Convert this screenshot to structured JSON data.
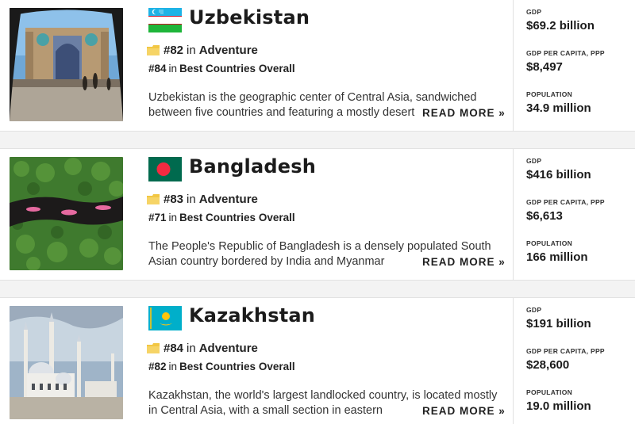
{
  "countries": [
    {
      "name": "Uzbekistan",
      "flag": "uzbekistan-flag",
      "rank_primary": {
        "number": "#82",
        "in": "in",
        "category": "Adventure"
      },
      "rank_secondary": {
        "number": "#84",
        "in": "in",
        "category": "Best Countries Overall"
      },
      "description": "Uzbekistan is the geographic center of Central Asia, sandwiched between five countries and featuring a mostly desert",
      "read_more": "READ MORE »",
      "stats": [
        {
          "label": "GDP",
          "value": "$69.2 billion"
        },
        {
          "label": "GDP PER CAPITA, PPP",
          "value": "$8,497"
        },
        {
          "label": "POPULATION",
          "value": "34.9 million"
        }
      ]
    },
    {
      "name": "Bangladesh",
      "flag": "bangladesh-flag",
      "rank_primary": {
        "number": "#83",
        "in": "in",
        "category": "Adventure"
      },
      "rank_secondary": {
        "number": "#71",
        "in": "in",
        "category": "Best Countries Overall"
      },
      "description": "The People's Republic of Bangladesh is a densely populated South Asian country bordered by India and Myanmar",
      "read_more": "READ MORE »",
      "stats": [
        {
          "label": "GDP",
          "value": "$416 billion"
        },
        {
          "label": "GDP PER CAPITA, PPP",
          "value": "$6,613"
        },
        {
          "label": "POPULATION",
          "value": "166 million"
        }
      ]
    },
    {
      "name": "Kazakhstan",
      "flag": "kazakhstan-flag",
      "rank_primary": {
        "number": "#84",
        "in": "in",
        "category": "Adventure"
      },
      "rank_secondary": {
        "number": "#82",
        "in": "in",
        "category": "Best Countries Overall"
      },
      "description": "Kazakhstan, the world's largest landlocked country, is located mostly in Central Asia, with a small section in eastern",
      "read_more": "READ MORE »",
      "stats": [
        {
          "label": "GDP",
          "value": "$191 billion"
        },
        {
          "label": "GDP PER CAPITA, PPP",
          "value": "$28,600"
        },
        {
          "label": "POPULATION",
          "value": "19.0 million"
        }
      ]
    }
  ],
  "colors": {
    "badge_gold": "#f2c744",
    "uzbek_blue": "#1eb3e6",
    "uzbek_green": "#1eb53a",
    "bangladesh_green": "#006a4e",
    "bangladesh_red": "#f42a41",
    "kazakh_blue": "#00afca",
    "kazakh_gold": "#fec50c"
  }
}
